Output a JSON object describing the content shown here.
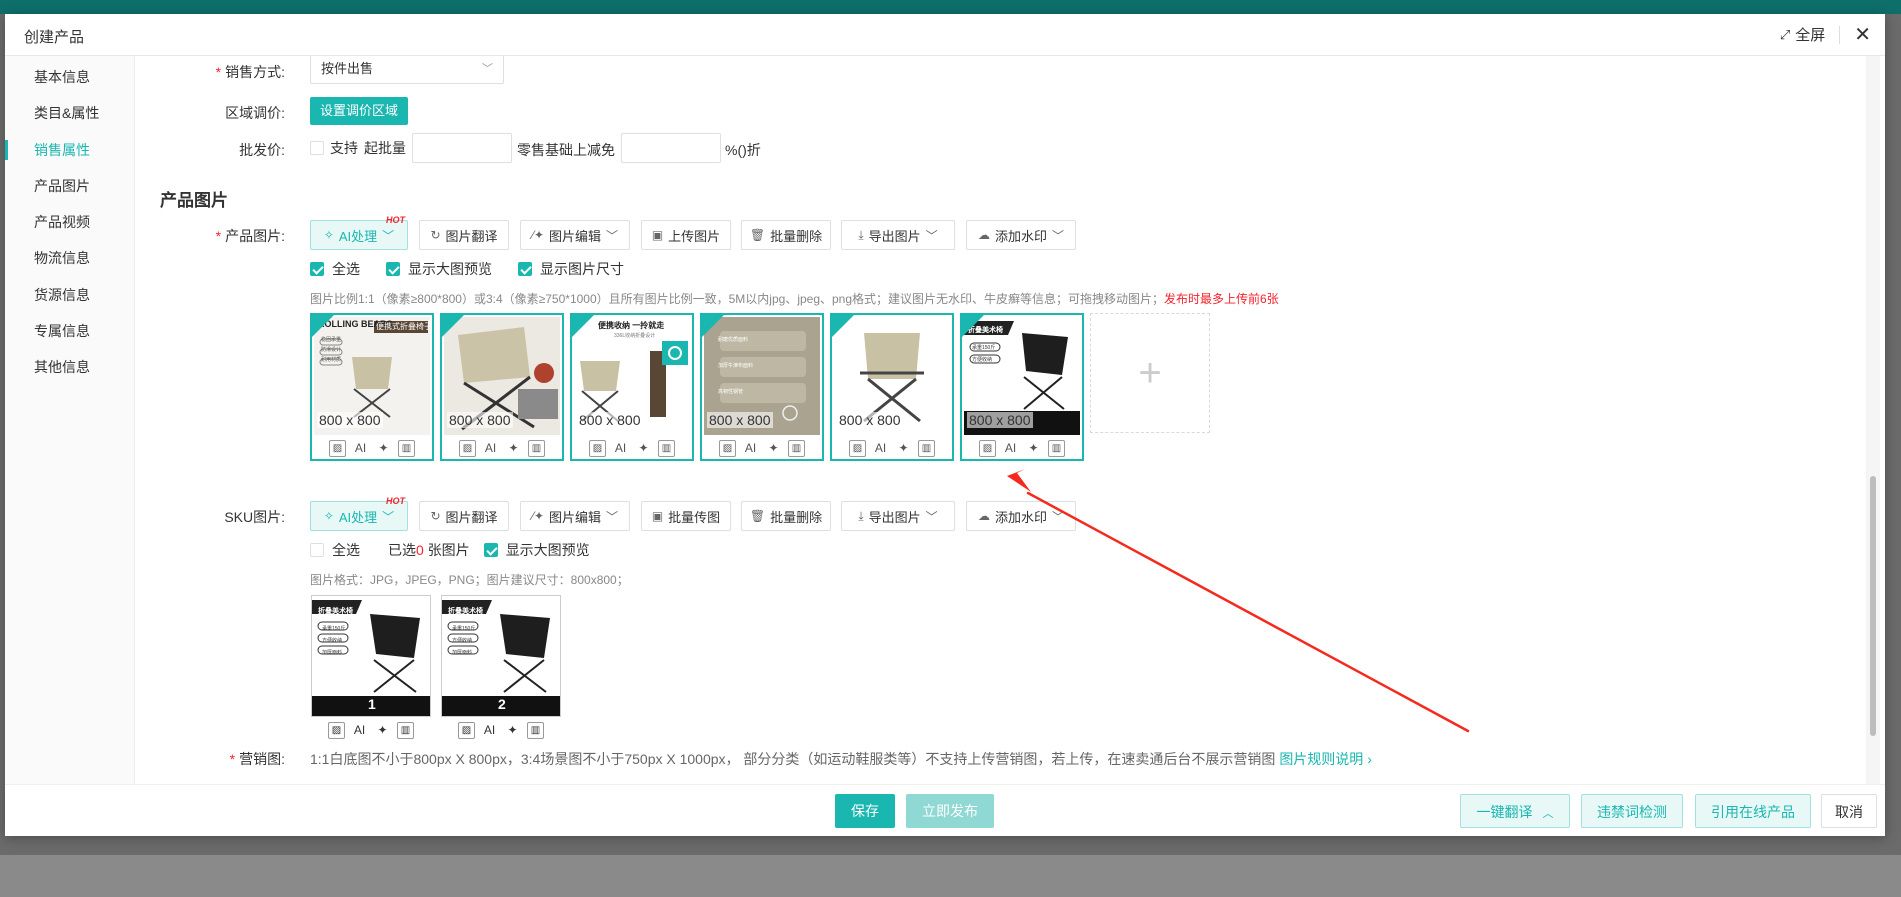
{
  "modal": {
    "title": "创建产品",
    "fullscreen_label": "全屏"
  },
  "sidenav": {
    "items": [
      {
        "label": "基本信息"
      },
      {
        "label": "类目&属性"
      },
      {
        "label": "销售属性"
      },
      {
        "label": "产品图片"
      },
      {
        "label": "产品视频"
      },
      {
        "label": "物流信息"
      },
      {
        "label": "货源信息"
      },
      {
        "label": "专属信息"
      },
      {
        "label": "其他信息"
      }
    ],
    "active": "销售属性"
  },
  "sales": {
    "method_label": "销售方式:",
    "method_value": "按件出售",
    "region_label": "区域调价:",
    "region_button": "设置调价区域",
    "wholesale_label": "批发价:",
    "support_label": "支持",
    "min_qty_label": "起批量",
    "discount_label": "零售基础上减免",
    "discount_suffix": "%()折"
  },
  "product_images": {
    "section_title": "产品图片",
    "field_label": "产品图片:",
    "toolbar": {
      "ai": "AI处理",
      "hot": "HOT",
      "translate": "图片翻译",
      "edit": "图片编辑",
      "upload": "上传图片",
      "batch_delete": "批量删除",
      "export": "导出图片",
      "watermark": "添加水印"
    },
    "checks": {
      "select_all": "全选",
      "show_preview": "显示大图预览",
      "show_size": "显示图片尺寸"
    },
    "hint": "图片比例1:1（像素≥800*800）或3:4（像素≥750*1000）且所有图片比例一致，5M以内jpg、jpeg、png格式；建议图片无水印、牛皮癣等信息；可拖拽移动图片；",
    "hint_red": "发布时最多上传前6张",
    "images": [
      {
        "size": "800 x 800",
        "ad_title": "ROLLING BEARS",
        "ad_badge": "便携式折叠椅子",
        "tags": [
          "稳固承重",
          "防滑设计",
          "耐用材质"
        ]
      },
      {
        "size": "800 x 800"
      },
      {
        "size": "800 x 800",
        "ad_title": "便携收纳 一拎就走",
        "ad_sub": "336L收纳折叠设计"
      },
      {
        "size": "800 x 800",
        "notes": [
          "耐磨优质面料",
          "加厚牛津布面料",
          "高韧性钢管"
        ]
      },
      {
        "size": "800 x 800"
      },
      {
        "size": "800 x 800",
        "ad_title": "折叠美术椅",
        "tags": [
          "承重150斤",
          "方便收纳"
        ]
      }
    ],
    "action_ai": "AI"
  },
  "sku_images": {
    "field_label": "SKU图片:",
    "toolbar": {
      "ai": "AI处理",
      "hot": "HOT",
      "translate": "图片翻译",
      "edit": "图片编辑",
      "batch_upload": "批量传图",
      "batch_delete": "批量删除",
      "export": "导出图片",
      "watermark": "添加水印"
    },
    "select_all": "全选",
    "selected_prefix": "已选",
    "selected_count": "0",
    "selected_suffix": "张图片",
    "show_preview": "显示大图预览",
    "hint": "图片格式：JPG，JPEG，PNG；图片建议尺寸：800x800；",
    "images": [
      {
        "number": "1",
        "ad_title": "折叠美术椅",
        "tags": [
          "承重150斤",
          "方便收纳",
          "加厚面料"
        ]
      },
      {
        "number": "2",
        "ad_title": "折叠美术椅",
        "tags": [
          "承重150斤",
          "方便收纳",
          "加厚面料"
        ]
      }
    ],
    "action_ai": "AI"
  },
  "marketing": {
    "label": "营销图:",
    "text": "1:1白底图不小于800px X 800px，3:4场景图不小于750px X 1000px， 部分分类（如运动鞋服类等）不支持上传营销图，若上传，在速卖通后台不展示营销图",
    "link": "图片规则说明"
  },
  "footer": {
    "save": "保存",
    "publish": "立即发布",
    "translate": "一键翻译",
    "banned_check": "违禁词检测",
    "cite_online": "引用在线产品",
    "cancel": "取消"
  },
  "colors": {
    "accent": "#19b7b0",
    "danger": "#f5222d",
    "annotation_arrow": "#f52a1e"
  }
}
